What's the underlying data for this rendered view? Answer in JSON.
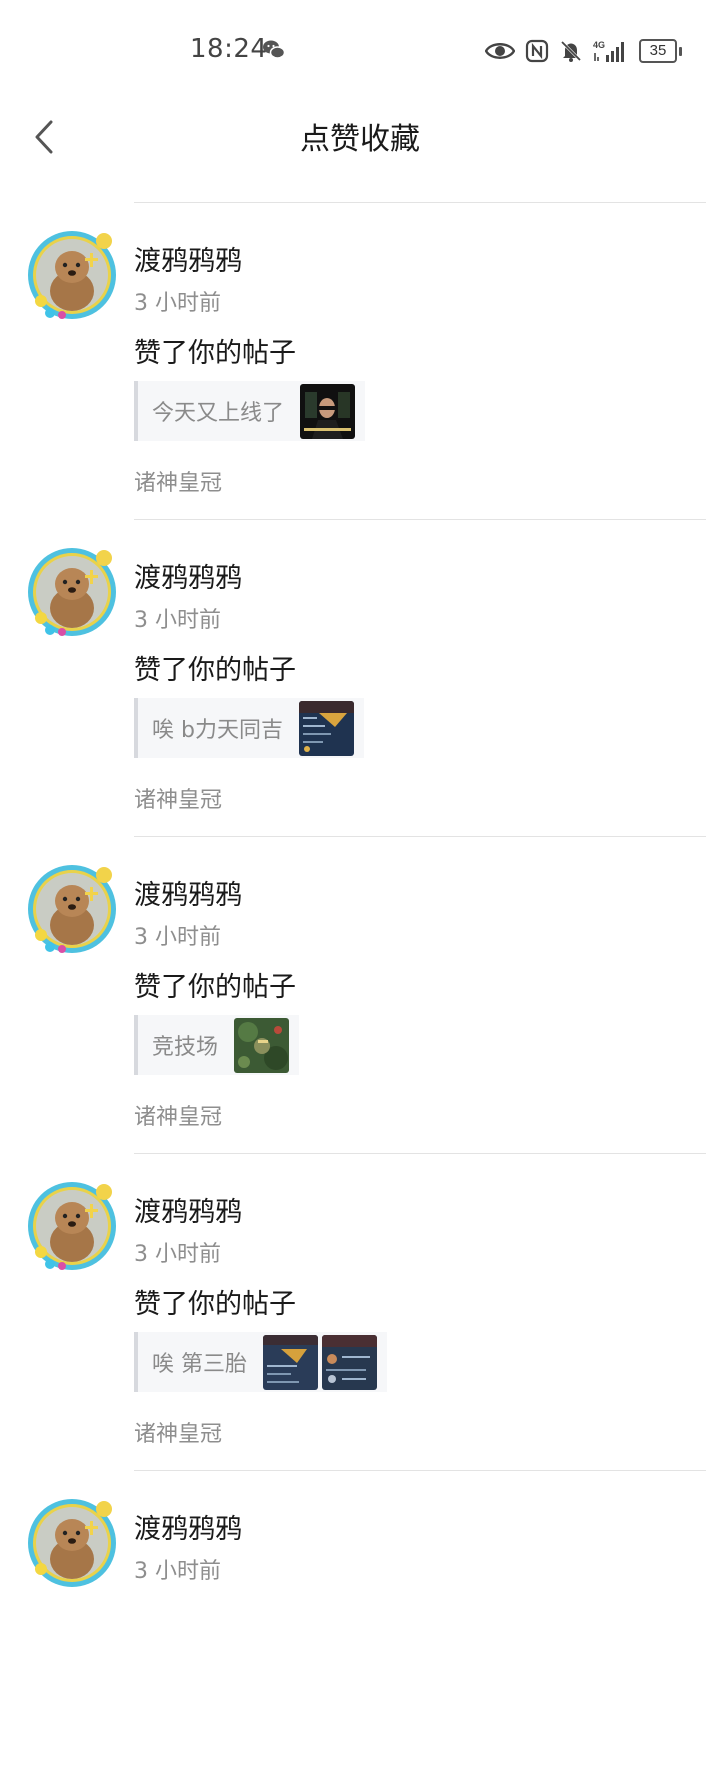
{
  "status_bar": {
    "time": "18:24",
    "icons": [
      "wechat-icon",
      "eye-icon",
      "nfc-icon",
      "bell-muted-icon",
      "signal-4g-icon",
      "battery-icon"
    ],
    "network": "4G",
    "battery_level": "35"
  },
  "header": {
    "title": "点赞收藏",
    "back_icon": "chevron-left-icon"
  },
  "notifications": [
    {
      "username": "渡鸦鸦鸦",
      "time": "3 小时前",
      "action": "赞了你的帖子",
      "post_title": "今天又上线了",
      "thumbnails": 1,
      "forum": "诸神皇冠"
    },
    {
      "username": "渡鸦鸦鸦",
      "time": "3 小时前",
      "action": "赞了你的帖子",
      "post_title": "唉 b力天同吉",
      "thumbnails": 1,
      "forum": "诸神皇冠"
    },
    {
      "username": "渡鸦鸦鸦",
      "time": "3 小时前",
      "action": "赞了你的帖子",
      "post_title": "竞技场",
      "thumbnails": 1,
      "forum": "诸神皇冠"
    },
    {
      "username": "渡鸦鸦鸦",
      "time": "3 小时前",
      "action": "赞了你的帖子",
      "post_title": "唉 第三胎",
      "thumbnails": 2,
      "forum": "诸神皇冠"
    },
    {
      "username": "渡鸦鸦鸦",
      "time": "3 小时前"
    }
  ]
}
